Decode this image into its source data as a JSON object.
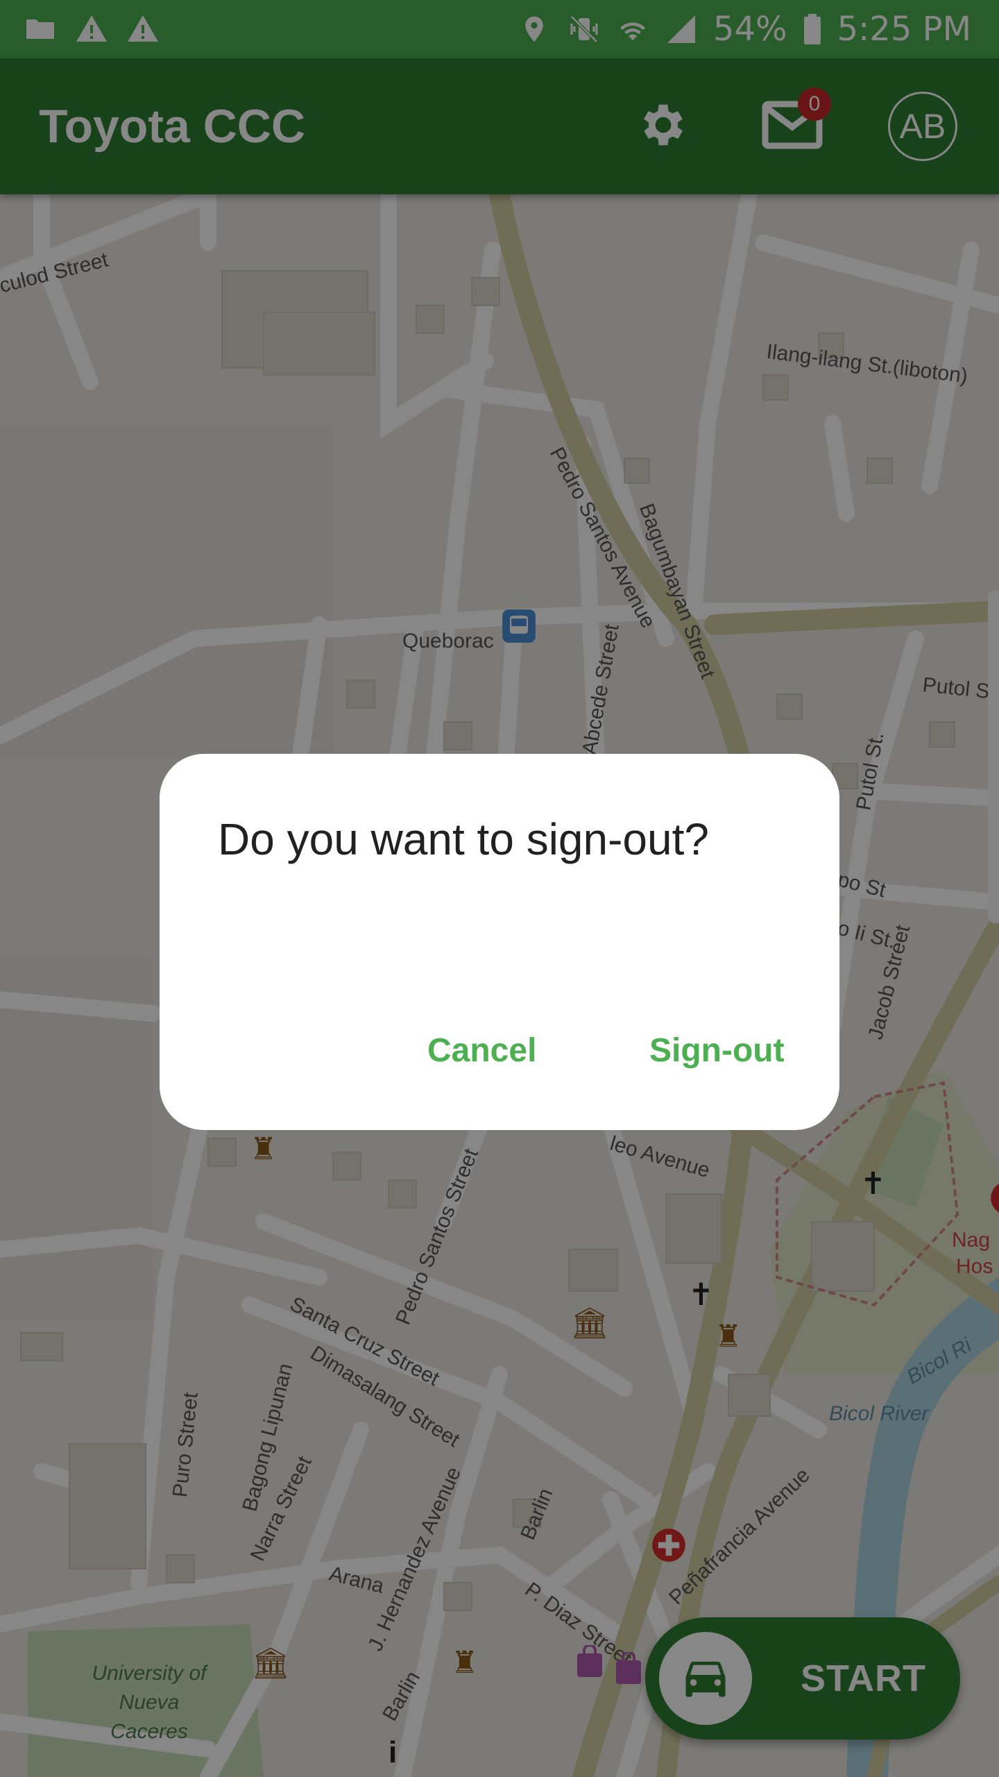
{
  "status_bar": {
    "left_icons": [
      "folder-icon",
      "warning-icon",
      "warning-icon"
    ],
    "right_icons": [
      "location-pin-icon",
      "vibrate-mute-icon",
      "wifi-icon",
      "signal-icon",
      "battery-icon"
    ],
    "battery": "54%",
    "time": "5:25 PM"
  },
  "app_bar": {
    "title": "Toyota CCC",
    "mail_badge": "0",
    "avatar_initials": "AB",
    "icons": [
      "gear-icon",
      "mail-icon"
    ]
  },
  "map": {
    "labels": {
      "culod": "culod Street",
      "ilang": "Ilang-ilang St.(liboton)",
      "pedro_top": "Pedro Santos Avenue",
      "bagumbayan": "Bagumbayan Street",
      "queborac": "Queborac",
      "abcede": "Abcede Street",
      "putol_s": "Putol S",
      "putol_st": "Putol St.",
      "jacob": "Jacob Street",
      "pedro_bottom": "Pedro Santos Street",
      "santa_cruz": "Santa Cruz Street",
      "dimasalang": "Dimasalang Street",
      "puro": "Puro Street",
      "bagong": "Bagong Lipunan",
      "narra": "Narra Street",
      "arana": "Arana",
      "hernandez": "J. Hernandez Avenue",
      "barlin1": "Barlin",
      "barlin2": "Barlin",
      "pdiaz": "P. Diaz Street",
      "penafrancia": "Peñafrancia Avenue",
      "bicol_river": "Bicol River",
      "bicol_ri": "Bicol Ri",
      "university": "University of Nueva Caceres",
      "naga": "Nag",
      "hos": "Hos",
      "leo": "leo Avenue",
      "po": "po St",
      "ii": "o Ii St."
    }
  },
  "fab": {
    "label": "START",
    "icon": "car-icon"
  },
  "dialog": {
    "title": "Do you want to sign-out?",
    "cancel_label": "Cancel",
    "confirm_label": "Sign-out"
  },
  "colors": {
    "status_bar": "#4caf50",
    "app_bar": "#2e7d32",
    "accent": "#4caf50",
    "badge": "#c62828"
  }
}
